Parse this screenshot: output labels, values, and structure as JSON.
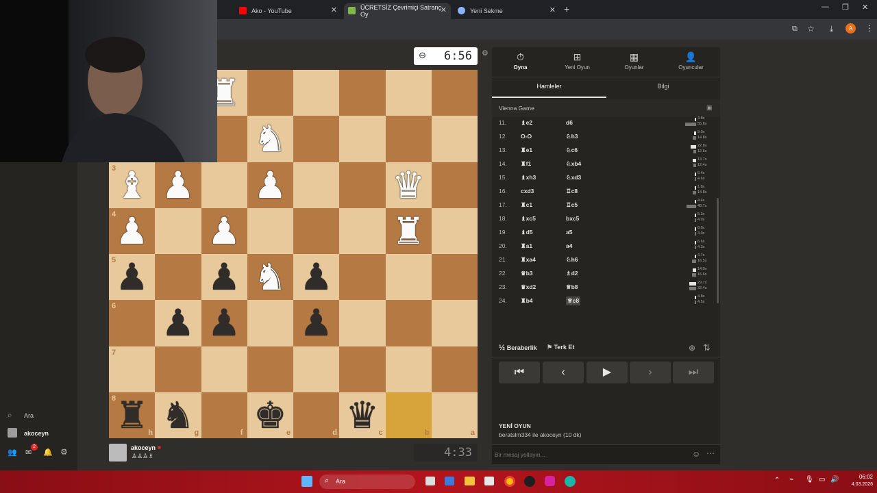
{
  "browser": {
    "tabs": [
      {
        "label": "Ako - YouTube",
        "active": false
      },
      {
        "label": "ÜCRETSİZ Çevrimiçi Satranç Oy",
        "active": true
      },
      {
        "label": "Yeni Sekme",
        "active": false
      }
    ],
    "new_tab": "+",
    "profile_initial": "A"
  },
  "sidebar": {
    "search_label": "Ara",
    "user_label": "akoceyn",
    "mail_badge": "2"
  },
  "board": {
    "rank_labels": [
      "3",
      "4",
      "5",
      "6",
      "7",
      "8"
    ],
    "file_labels": [
      "h",
      "g",
      "f",
      "e",
      "d",
      "c",
      "b",
      "a"
    ]
  },
  "clocks": {
    "top": "6:56",
    "bottom": "4:33"
  },
  "player_bottom": {
    "name": "akoceyn"
  },
  "panel": {
    "nav": [
      {
        "label": "Oyna",
        "icon": "timer-icon"
      },
      {
        "label": "Yeni Oyun",
        "icon": "plus-icon"
      },
      {
        "label": "Oyunlar",
        "icon": "board-icon"
      },
      {
        "label": "Oyuncular",
        "icon": "players-icon"
      }
    ],
    "tabs": [
      "Hamleler",
      "Bilgi"
    ],
    "opening": "Vienna Game",
    "moves": [
      {
        "n": "11.",
        "w": "♝e2",
        "b": "d6",
        "tw": "4.8s",
        "tb": "55.6s",
        "bw": 0.15,
        "bb": 1.0
      },
      {
        "n": "12.",
        "w": "O-O",
        "b": "♘h3",
        "tw": "9.0s",
        "tb": "14.8s",
        "bw": 0.2,
        "bb": 0.3
      },
      {
        "n": "13.",
        "w": "♜e1",
        "b": "♘c6",
        "tw": "22.8s",
        "tb": "12.5s",
        "bw": 0.5,
        "bb": 0.25
      },
      {
        "n": "14.",
        "w": "♜f1",
        "b": "♘xb4",
        "tw": "13.7s",
        "tb": "12.4s",
        "bw": 0.3,
        "bb": 0.25
      },
      {
        "n": "15.",
        "w": "♝xh3",
        "b": "♘xd3",
        "tw": "6.4s",
        "tb": "4.6s",
        "bw": 0.15,
        "bb": 0.1
      },
      {
        "n": "16.",
        "w": "cxd3",
        "b": "♖c8",
        "tw": "1.8s",
        "tb": "14.8s",
        "bw": 0.05,
        "bb": 0.3
      },
      {
        "n": "17.",
        "w": "♜c1",
        "b": "♖c5",
        "tw": "4.4s",
        "tb": "48.7s",
        "bw": 0.1,
        "bb": 0.9
      },
      {
        "n": "18.",
        "w": "♝xc5",
        "b": "bxc5",
        "tw": "5.3s",
        "tb": "4.0s",
        "bw": 0.1,
        "bb": 0.1
      },
      {
        "n": "19.",
        "w": "♝d5",
        "b": "a5",
        "tw": "8.0s",
        "tb": "3.0s",
        "bw": 0.15,
        "bb": 0.05
      },
      {
        "n": "20.",
        "w": "♜a1",
        "b": "a4",
        "tw": "6.6s",
        "tb": "4.3s",
        "bw": 0.15,
        "bb": 0.1
      },
      {
        "n": "21.",
        "w": "♜xa4",
        "b": "♘h6",
        "tw": "4.7s",
        "tb": "16.5s",
        "bw": 0.1,
        "bb": 0.35
      },
      {
        "n": "22.",
        "w": "♛b3",
        "b": "♗d2",
        "tw": "14.0s",
        "tb": "16.6s",
        "bw": 0.3,
        "bb": 0.35
      },
      {
        "n": "23.",
        "w": "♛xd2",
        "b": "♕b8",
        "tw": "29.7s",
        "tb": "32.4s",
        "bw": 0.6,
        "bb": 0.65
      },
      {
        "n": "24.",
        "w": "♜b4",
        "b": "♕c8",
        "tw": "4.8s",
        "tb": "4.5s",
        "bw": 0.1,
        "bb": 0.1
      }
    ],
    "controls": [
      "⏮",
      "‹",
      "▶",
      "›",
      "⏭"
    ],
    "draw_label": "Beraberlik",
    "draw_prefix": "½",
    "resign_label": "Terk Et",
    "new_game_title": "YENİ OYUN",
    "new_game_desc": "beratslm334 ile akoceyn (10 dk)",
    "chat_placeholder": "Bir mesaj yollayın..."
  },
  "taskbar": {
    "search_label": "Ara",
    "time": "06:02",
    "date": "4.03.2026"
  },
  "colors": {
    "light_square": "#e8c99b",
    "dark_square": "#b57a44",
    "highlight": "#d6a43a",
    "taskbar": "#b3141c"
  }
}
